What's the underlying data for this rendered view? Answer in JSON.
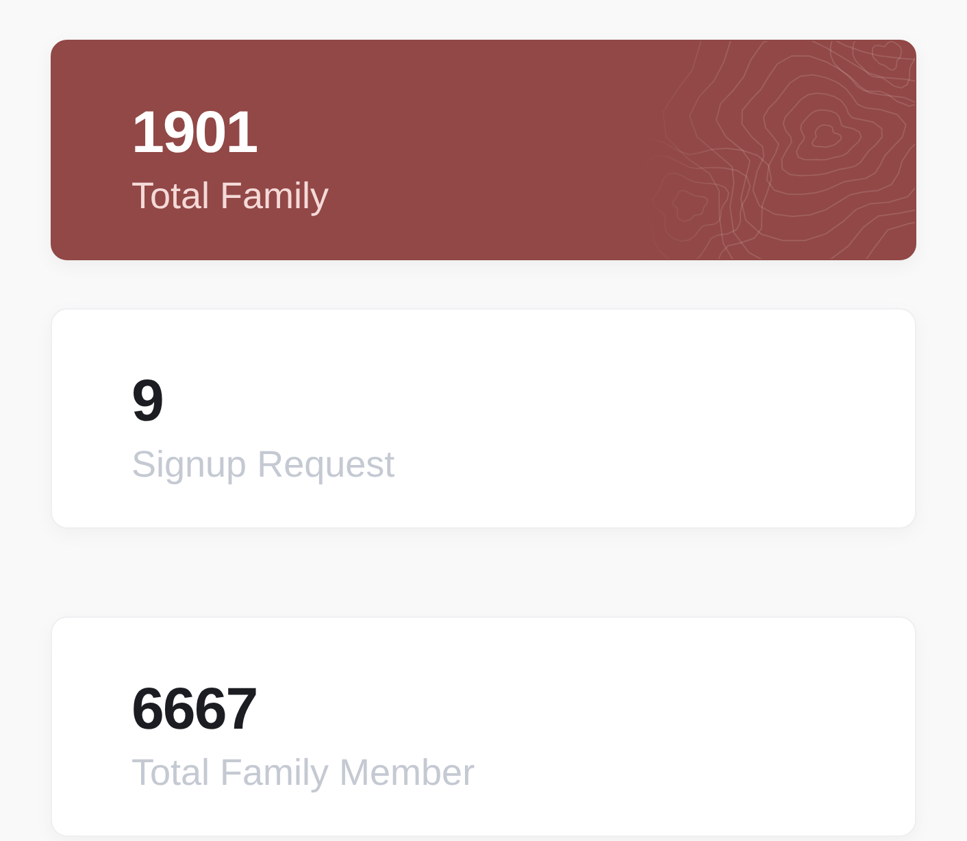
{
  "sections": [
    {
      "cards": [
        {
          "kind": "highlight",
          "value": "1901",
          "label": "Total Family"
        },
        {
          "kind": "plain",
          "value": "9",
          "label": "Signup Request"
        }
      ]
    },
    {
      "cards": [
        {
          "kind": "plain",
          "value": "6667",
          "label": "Total Family Member"
        }
      ]
    }
  ]
}
